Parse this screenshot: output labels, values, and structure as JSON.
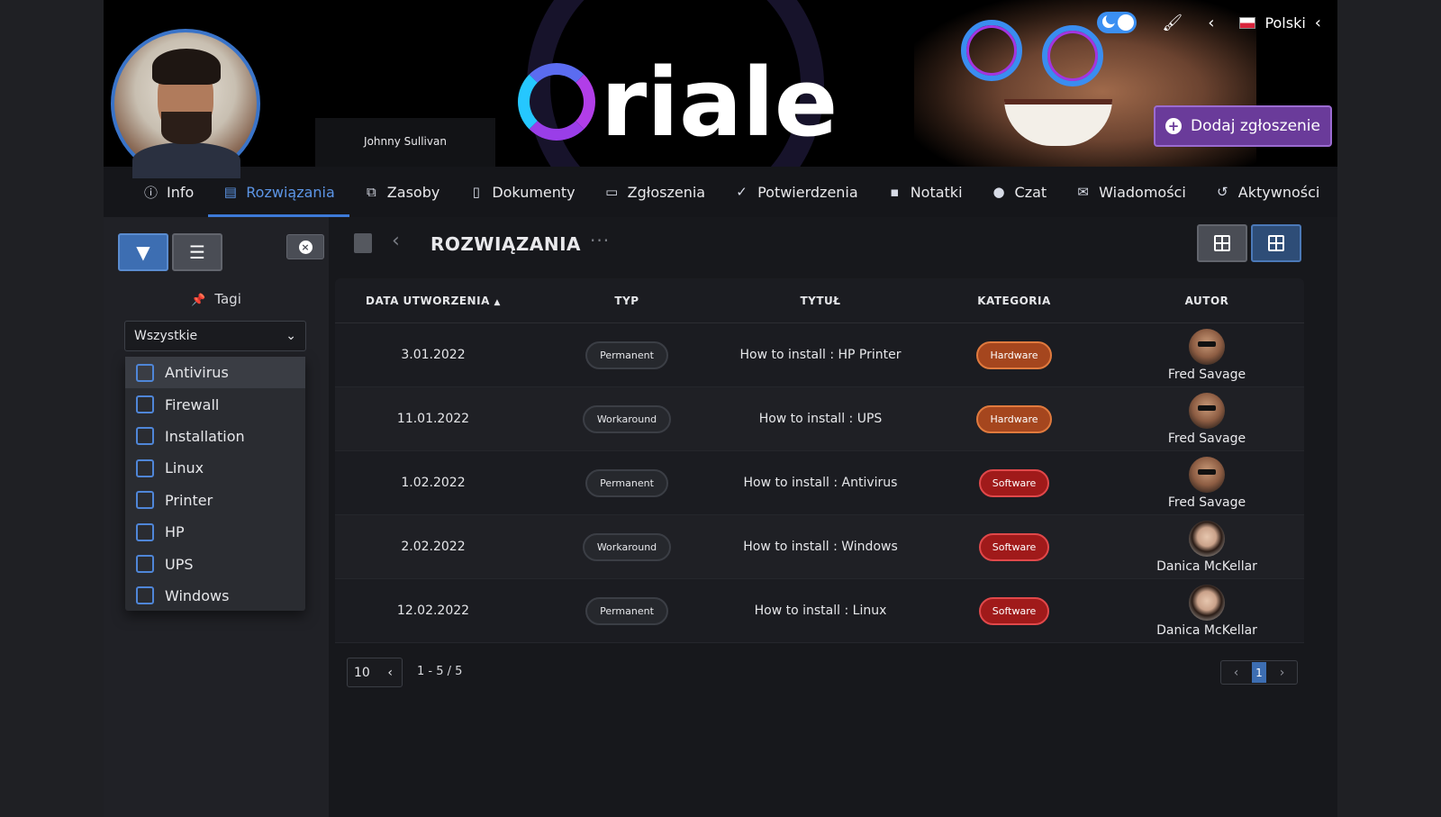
{
  "header": {
    "logo_text": "riale",
    "user_name": "Johnny Sullivan",
    "language": "Polski",
    "add_button": "Dodaj zgłoszenie"
  },
  "tabs": [
    {
      "label": "Info",
      "icon": "info-icon"
    },
    {
      "label": "Rozwiązania",
      "icon": "book-icon",
      "active": true
    },
    {
      "label": "Zasoby",
      "icon": "cubes-icon"
    },
    {
      "label": "Dokumenty",
      "icon": "file-icon"
    },
    {
      "label": "Zgłoszenia",
      "icon": "ticket-icon"
    },
    {
      "label": "Potwierdzenia",
      "icon": "user-check-icon"
    },
    {
      "label": "Notatki",
      "icon": "note-icon"
    },
    {
      "label": "Czat",
      "icon": "chat-icon"
    },
    {
      "label": "Wiadomości",
      "icon": "envelope-icon"
    },
    {
      "label": "Aktywności",
      "icon": "history-icon"
    }
  ],
  "sidebar": {
    "tags_label": "Tagi",
    "select_value": "Wszystkie",
    "options": [
      "Antivirus",
      "Firewall",
      "Installation",
      "Linux",
      "Printer",
      "HP",
      "UPS",
      "Windows"
    ]
  },
  "main": {
    "title": "ROZWIĄZANIA",
    "columns": [
      "DATA UTWORZENIA",
      "TYP",
      "TYTUŁ",
      "KATEGORIA",
      "AUTOR"
    ],
    "rows": [
      {
        "date": "3.01.2022",
        "type": "Permanent",
        "title": "How to install : HP Printer",
        "category": "Hardware",
        "author": "Fred Savage"
      },
      {
        "date": "11.01.2022",
        "type": "Workaround",
        "title": "How to install : UPS",
        "category": "Hardware",
        "author": "Fred Savage"
      },
      {
        "date": "1.02.2022",
        "type": "Permanent",
        "title": "How to install : Antivirus",
        "category": "Software",
        "author": "Fred Savage"
      },
      {
        "date": "2.02.2022",
        "type": "Workaround",
        "title": "How to install : Windows",
        "category": "Software",
        "author": "Danica McKellar"
      },
      {
        "date": "12.02.2022",
        "type": "Permanent",
        "title": "How to install : Linux",
        "category": "Software",
        "author": "Danica McKellar"
      }
    ],
    "page_size": "10",
    "range": "1 - 5 / 5",
    "current_page": "1"
  },
  "colors": {
    "accent": "#3d7ad8",
    "hardware": "#a5461e",
    "software": "#a01a1a",
    "add_button": "#6a3b9a"
  }
}
